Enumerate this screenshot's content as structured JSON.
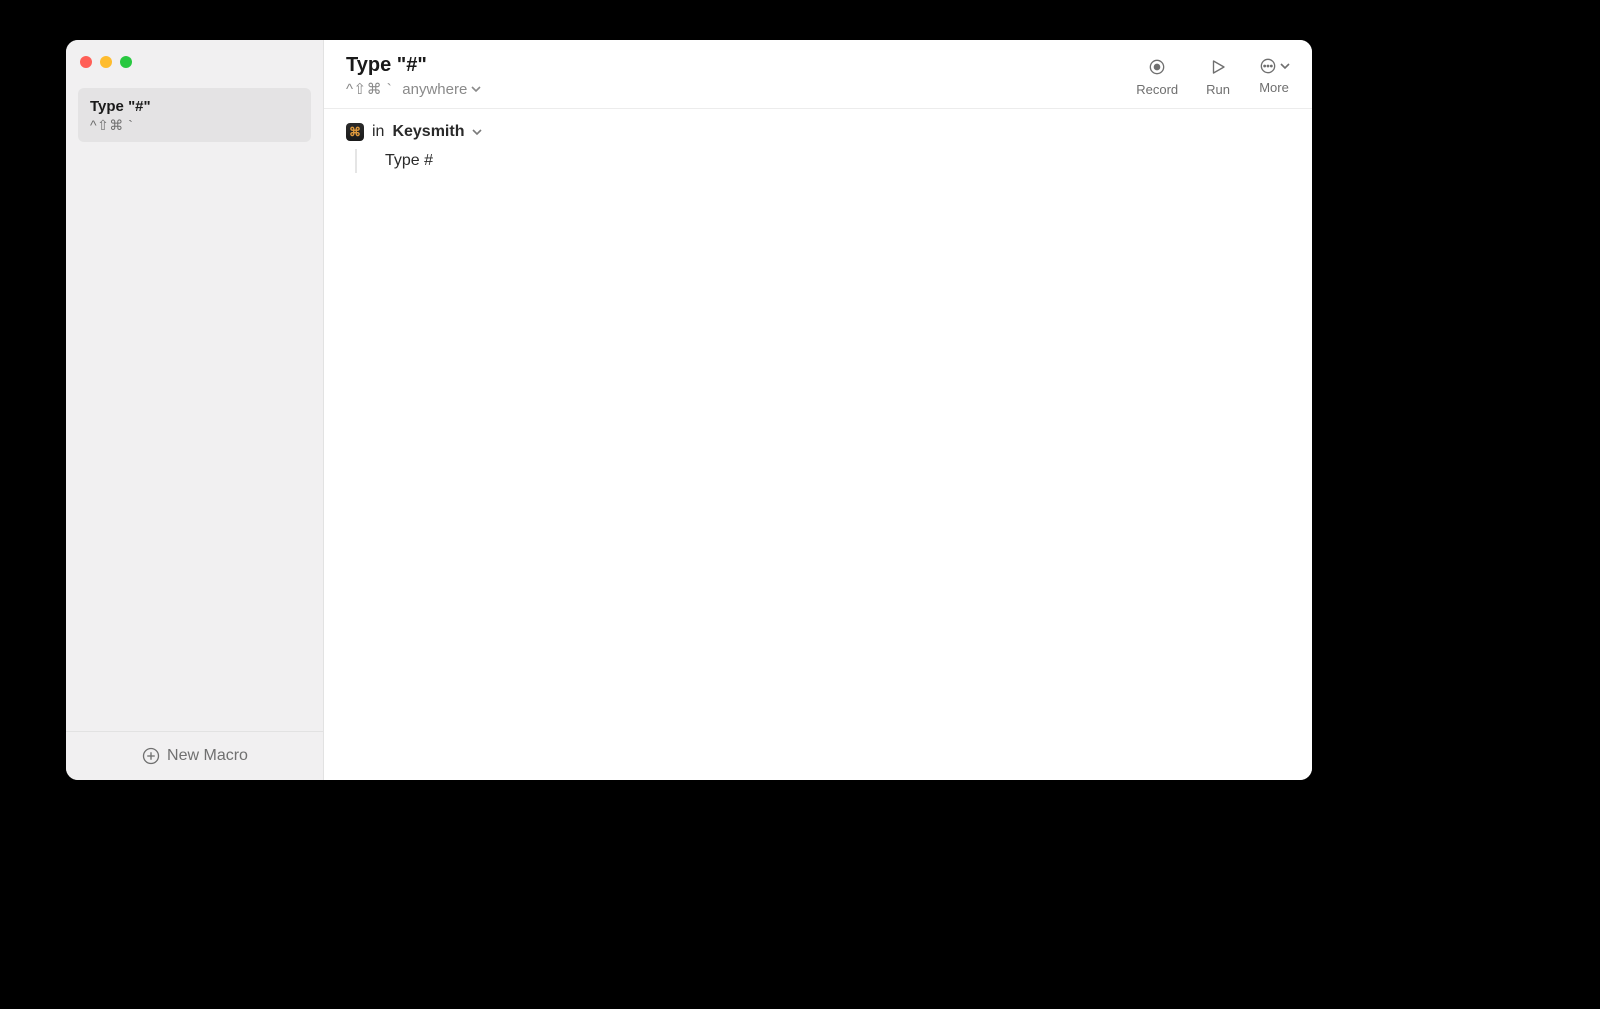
{
  "sidebar": {
    "items": [
      {
        "title": "Type \"#\"",
        "shortcut": "^⇧⌘ `"
      }
    ],
    "footer_label": "New Macro"
  },
  "header": {
    "title": "Type \"#\"",
    "shortcut": "^⇧⌘ `",
    "scope_label": "anywhere",
    "actions": {
      "record": "Record",
      "run": "Run",
      "more": "More"
    }
  },
  "content": {
    "step_context_prefix": "in",
    "step_context_app": "Keysmith",
    "step_action": "Type #"
  }
}
